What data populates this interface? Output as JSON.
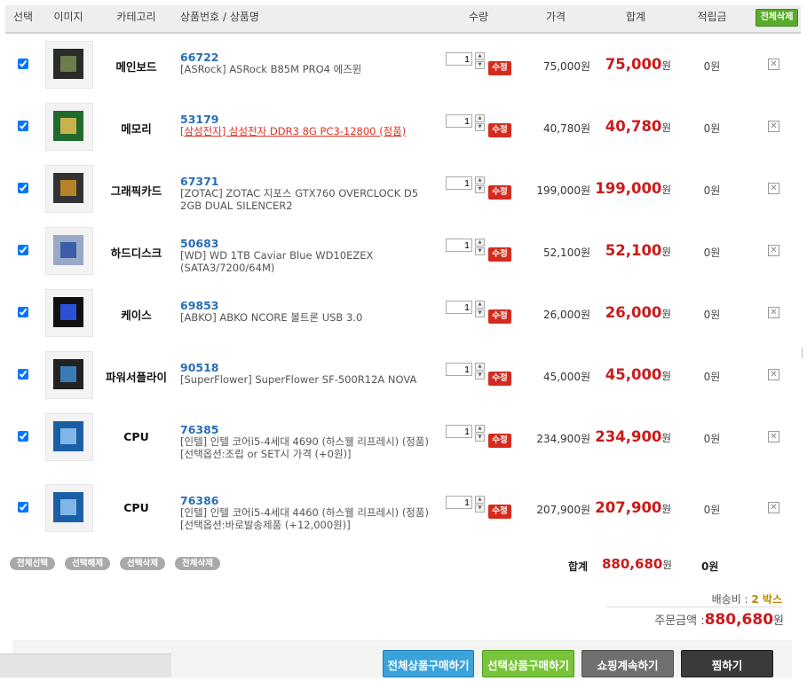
{
  "header": {
    "select": "선택",
    "image": "이미지",
    "category": "카테고리",
    "product": "상품번호 / 상품명",
    "qty": "수량",
    "price": "가격",
    "total": "합계",
    "points": "적립금",
    "delete_all": "전체삭제"
  },
  "labels": {
    "modify": "수정",
    "won": "원"
  },
  "items": [
    {
      "category": "메인보드",
      "code": "66722",
      "name": "[ASRock] ASRock B85M PRO4 에즈윈",
      "qty": "1",
      "price": "75,000원",
      "total": "75,000",
      "points": "0원",
      "link": false
    },
    {
      "category": "메모리",
      "code": "53179",
      "name": "[삼성전자] 삼성전자 DDR3 8G PC3-12800 (정품)",
      "qty": "1",
      "price": "40,780원",
      "total": "40,780",
      "points": "0원",
      "link": true
    },
    {
      "category": "그래픽카드",
      "code": "67371",
      "name": "[ZOTAC] ZOTAC 지포스 GTX760 OVERCLOCK D5 2GB DUAL SILENCER2",
      "qty": "1",
      "price": "199,000원",
      "total": "199,000",
      "points": "0원",
      "link": false
    },
    {
      "category": "하드디스크",
      "code": "50683",
      "name": "[WD] WD 1TB Caviar Blue WD10EZEX (SATA3/7200/64M)",
      "qty": "1",
      "price": "52,100원",
      "total": "52,100",
      "points": "0원",
      "link": false
    },
    {
      "category": "케이스",
      "code": "69853",
      "name": "[ABKO] ABKO NCORE 볼트론 USB 3.0",
      "qty": "1",
      "price": "26,000원",
      "total": "26,000",
      "points": "0원",
      "link": false
    },
    {
      "category": "파워서플라이",
      "code": "90518",
      "name": "[SuperFlower] SuperFlower SF-500R12A NOVA",
      "qty": "1",
      "price": "45,000원",
      "total": "45,000",
      "points": "0원",
      "link": false
    },
    {
      "category": "CPU",
      "code": "76385",
      "name": "[인텔] 인텔 코어i5-4세대 4690 (하스웰 리프레시) (정품)                    [선택옵션:조립 or SET시 가격 (+0원)]",
      "qty": "1",
      "price": "234,900원",
      "total": "234,900",
      "points": "0원",
      "link": false
    },
    {
      "category": "CPU",
      "code": "76386",
      "name": "[인텔] 인텔 코어i5-4세대 4460 (하스웰 리프레시) (정품)                    [선택옵션:바로발송제품 (+12,000원)]",
      "qty": "1",
      "price": "207,900원",
      "total": "207,900",
      "points": "0원",
      "link": false
    }
  ],
  "footer": {
    "select_all": "전체선택",
    "deselect": "선택해제",
    "delete_selected": "선택삭제",
    "delete_all": "전체삭제",
    "sum_label": "합계",
    "sum_value": "880,680",
    "sum_points": "0원",
    "shipping_label": "배송비 : ",
    "shipping_value": "2 박스",
    "order_label": "주문금액 :",
    "order_value": "880,680"
  },
  "buttons": {
    "buy_all": "전체상품구매하기",
    "buy_selected": "선택상품구매하기",
    "continue": "쇼핑계속하기",
    "wishlist": "찜하기"
  },
  "icons": [
    "checkbox-icon",
    "arrow-up-icon",
    "arrow-down-icon",
    "close-icon"
  ]
}
